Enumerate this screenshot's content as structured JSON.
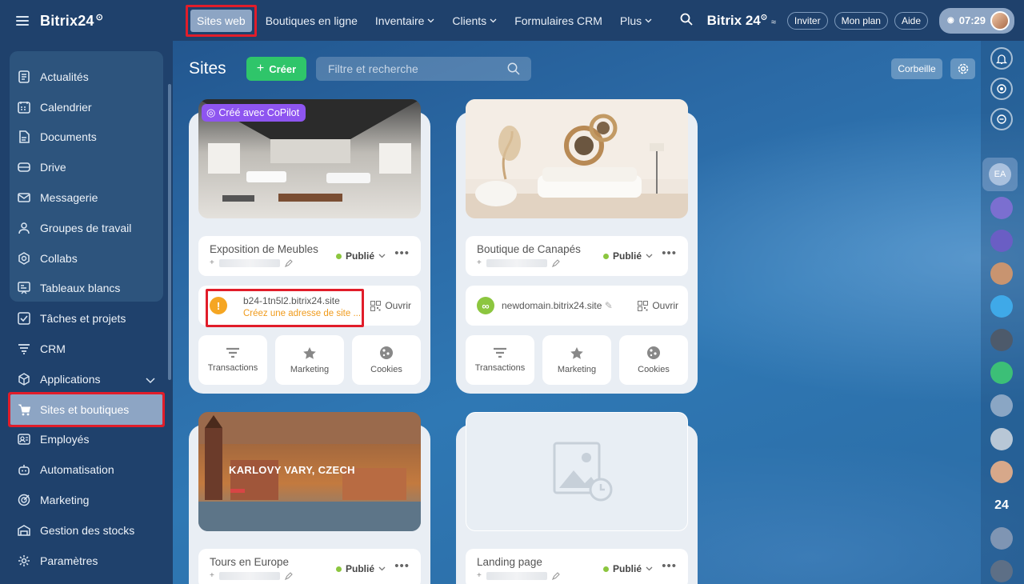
{
  "brand": {
    "name": "Bitrix24",
    "mark": "⊙"
  },
  "sidebar": {
    "items": [
      {
        "label": "Actualités",
        "icon": "news-icon"
      },
      {
        "label": "Calendrier",
        "icon": "calendar-icon"
      },
      {
        "label": "Documents",
        "icon": "document-icon"
      },
      {
        "label": "Drive",
        "icon": "drive-icon"
      },
      {
        "label": "Messagerie",
        "icon": "mail-icon"
      },
      {
        "label": "Groupes de travail",
        "icon": "group-icon"
      },
      {
        "label": "Collabs",
        "icon": "collabs-icon"
      },
      {
        "label": "Tableaux blancs",
        "icon": "whiteboard-icon"
      },
      {
        "label": "Tâches et projets",
        "icon": "tasks-icon"
      },
      {
        "label": "CRM",
        "icon": "crm-icon"
      },
      {
        "label": "Applications",
        "icon": "applications-icon"
      },
      {
        "label": "Sites et boutiques",
        "icon": "cart-icon"
      },
      {
        "label": "Employés",
        "icon": "employees-icon"
      },
      {
        "label": "Automatisation",
        "icon": "robot-icon"
      },
      {
        "label": "Marketing",
        "icon": "marketing-icon"
      },
      {
        "label": "Gestion des stocks",
        "icon": "store-icon"
      },
      {
        "label": "Paramètres",
        "icon": "settings-icon"
      }
    ]
  },
  "topnav": {
    "items": [
      "Sites web",
      "Boutiques en ligne",
      "Inventaire",
      "Clients",
      "Formulaires CRM",
      "Plus"
    ],
    "brand": "Bitrix 24",
    "invite": "Inviter",
    "plan": "Mon plan",
    "help": "Aide",
    "time": "07:29"
  },
  "page": {
    "title": "Sites",
    "create": "Créer",
    "search_placeholder": "Filtre et recherche",
    "trash": "Corbeille"
  },
  "cards": [
    {
      "name": "Exposition de Meubles",
      "status": "Publié",
      "badge": "Créé avec CoPilot",
      "domain": "b24-1tn5l2.bitrix24.site",
      "warning": "Créez une adresse de site ...",
      "open": "Ouvrir",
      "actions": [
        "Transactions",
        "Marketing",
        "Cookies"
      ]
    },
    {
      "name": "Boutique de Canapés",
      "status": "Publié",
      "domain": "newdomain.bitrix24.site",
      "open": "Ouvrir",
      "actions": [
        "Transactions",
        "Marketing",
        "Cookies"
      ]
    },
    {
      "name": "Tours en Europe",
      "status": "Publié",
      "thumb_text": "KARLOVY VARY, CZECH"
    },
    {
      "name": "Landing page",
      "status": "Publié"
    }
  ],
  "rail": {
    "initials": "EA",
    "badge24": "24"
  },
  "colors": {
    "accent_green": "#2fc56a",
    "highlight": "#e11d2a",
    "copilot": "#8e55f0",
    "status_dot": "#8cc63f",
    "warning": "#f09b1c"
  }
}
